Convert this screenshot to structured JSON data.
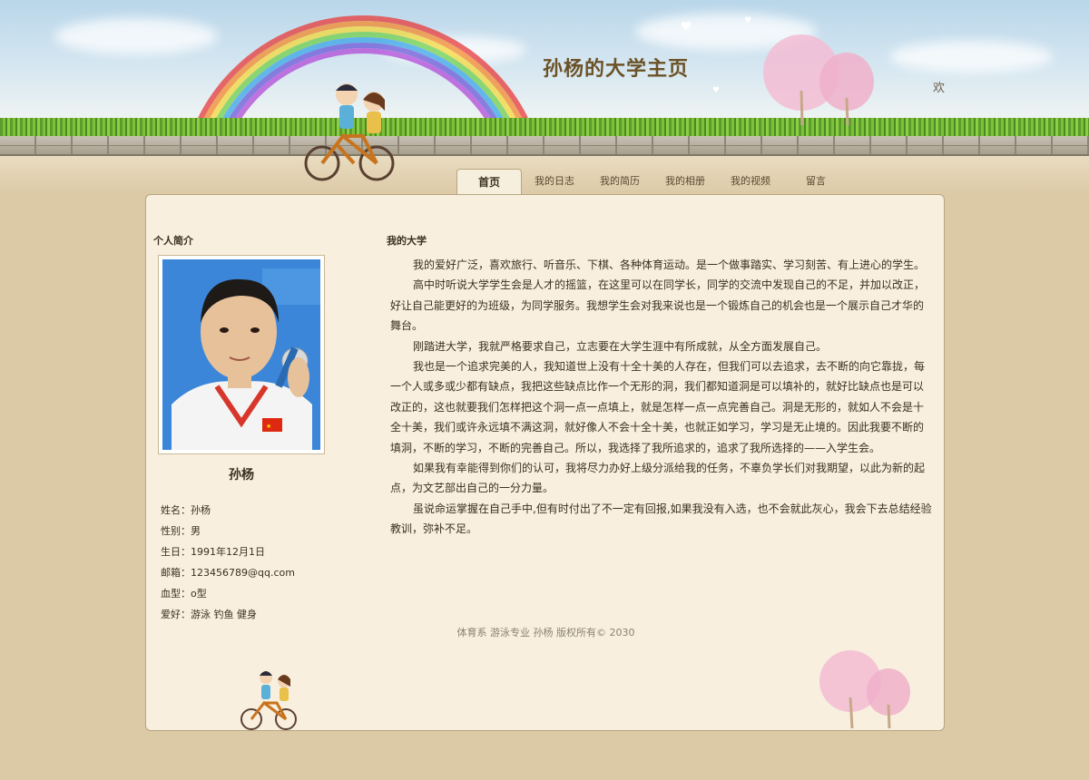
{
  "site": {
    "title": "孙杨的大学主页",
    "welcome": "欢"
  },
  "nav": {
    "tabs": [
      {
        "label": "首页",
        "active": true
      },
      {
        "label": "我的日志",
        "active": false
      },
      {
        "label": "我的简历",
        "active": false
      },
      {
        "label": "我的相册",
        "active": false
      },
      {
        "label": "我的视频",
        "active": false
      },
      {
        "label": "留言",
        "active": false
      }
    ]
  },
  "sidebar": {
    "title": "个人简介",
    "name": "孙杨",
    "profile": [
      "姓名：孙杨",
      "性别：男",
      "生日：1991年12月1日",
      "邮箱：123456789@qq.com",
      "血型：o型",
      "爱好：游泳 钓鱼 健身"
    ]
  },
  "main": {
    "title": "我的大学",
    "paragraphs": [
      "我的爱好广泛，喜欢旅行、听音乐、下棋、各种体育运动。是一个做事踏实、学习刻苦、有上进心的学生。",
      "高中时听说大学学生会是人才的摇篮，在这里可以在同学长，同学的交流中发现自己的不足，并加以改正，好让自己能更好的为班级，为同学服务。我想学生会对我来说也是一个锻炼自己的机会也是一个展示自己才华的舞台。",
      "刚踏进大学，我就严格要求自己，立志要在大学生涯中有所成就，从全方面发展自己。",
      "我也是一个追求完美的人，我知道世上没有十全十美的人存在，但我们可以去追求，去不断的向它靠拢，每一个人或多或少都有缺点，我把这些缺点比作一个无形的洞，我们都知道洞是可以填补的，就好比缺点也是可以改正的，这也就要我们怎样把这个洞一点一点填上，就是怎样一点一点完善自己。洞是无形的，就如人不会是十全十美，我们或许永远填不满这洞，就好像人不会十全十美，也就正如学习，学习是无止境的。因此我要不断的填洞，不断的学习，不断的完善自己。所以，我选择了我所追求的，追求了我所选择的——入学生会。",
      "如果我有幸能得到你们的认可，我将尽力办好上级分派给我的任务，不辜负学长们对我期望，以此为新的起点，为文艺部出自己的一分力量。",
      "虽说命运掌握在自己手中,但有时付出了不一定有回报,如果我没有入选，也不会就此灰心，我会下去总结经验教训，弥补不足。"
    ]
  },
  "footer": {
    "text": "体育系 游泳专业   孙杨   版权所有© 2030"
  },
  "colors": {
    "title": "#6b5227",
    "panel": "#f8efdf",
    "border": "#b8a67f",
    "background": "#dcc9a6"
  },
  "icons": [
    "rainbow-icon",
    "bicycle-couple-icon",
    "cherry-tree-icon",
    "heart-icon"
  ]
}
